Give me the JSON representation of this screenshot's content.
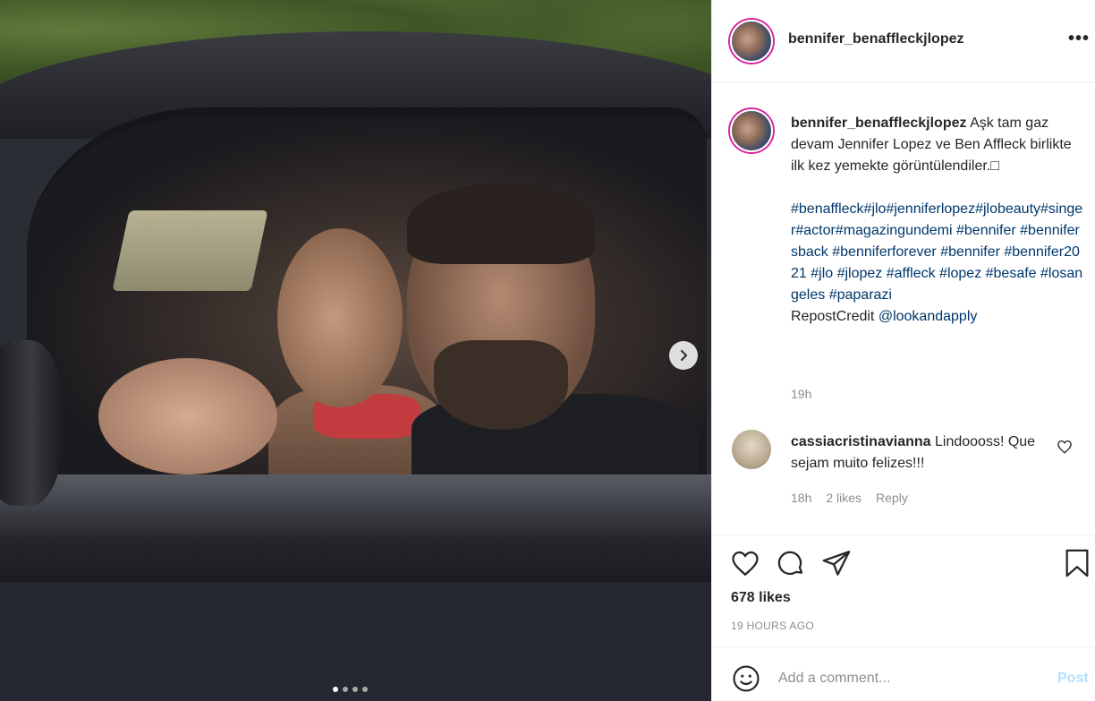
{
  "post": {
    "username": "bennifer_benaffleckjlopez",
    "more_icon": "more-icon",
    "photo": {
      "carousel_count": 4,
      "active_index": 0,
      "next_icon": "chevron-right-icon"
    }
  },
  "caption": {
    "username": "bennifer_benaffleckjlopez",
    "body": "Aşk tam gaz devam Jennifer Lopez ve Ben Affleck birlikte ilk kez yemekte görüntülendiler.□",
    "hashtags": "#benaffleck#jlo#jenniferlopez#jlobeauty#singer#actor#magazingundemi #bennifer #bennifersback #benniferforever #bennifer #bennifer2021 #jlo #jlopez #affleck #lopez #besafe #losangeles #paparazi",
    "credit_prefix": "RepostCredit ",
    "credit_handle": "@lookandapply",
    "time": "19h"
  },
  "comment": {
    "username": "cassiacristinavianna",
    "text": "Lindoooss! Que sejam muito felizes!!!",
    "time": "18h",
    "likes": "2 likes",
    "reply": "Reply",
    "heart_icon": "heart-outline-icon"
  },
  "actions": {
    "like_icon": "heart-icon",
    "comment_icon": "comment-icon",
    "share_icon": "send-icon",
    "save_icon": "bookmark-icon",
    "likes": "678 likes",
    "ago": "19 HOURS AGO"
  },
  "composer": {
    "emoji_icon": "smiley-icon",
    "placeholder": "Add a comment...",
    "post_label": "Post"
  }
}
